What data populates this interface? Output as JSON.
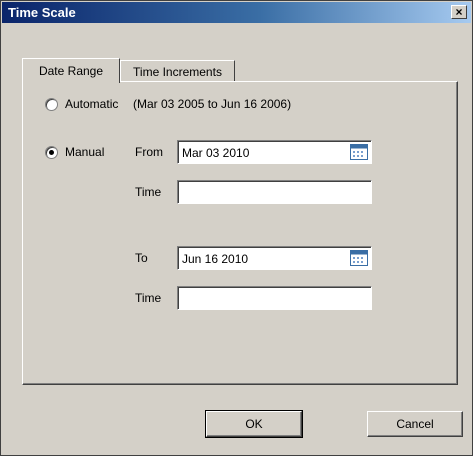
{
  "window": {
    "title": "Time Scale",
    "close_symbol": "×"
  },
  "tabs": [
    {
      "label": "Date Range",
      "active": true
    },
    {
      "label": "Time Increments",
      "active": false
    }
  ],
  "options": {
    "automatic": {
      "label": "Automatic",
      "selected": false,
      "range_text": "(Mar 03 2005 to Jun 16 2006)"
    },
    "manual": {
      "label": "Manual",
      "selected": true
    }
  },
  "from": {
    "label": "From",
    "date_value": "Mar 03 2010",
    "time_label": "Time",
    "time_value": ""
  },
  "to": {
    "label": "To",
    "date_value": "Jun 16 2010",
    "time_label": "Time",
    "time_value": ""
  },
  "buttons": {
    "ok": "OK",
    "cancel": "Cancel"
  },
  "icons": {
    "calendar": "calendar-icon",
    "close": "close-icon"
  },
  "colors": {
    "title_gradient_start": "#0a246a",
    "title_gradient_end": "#a6caf0",
    "face": "#d4d0c8"
  }
}
